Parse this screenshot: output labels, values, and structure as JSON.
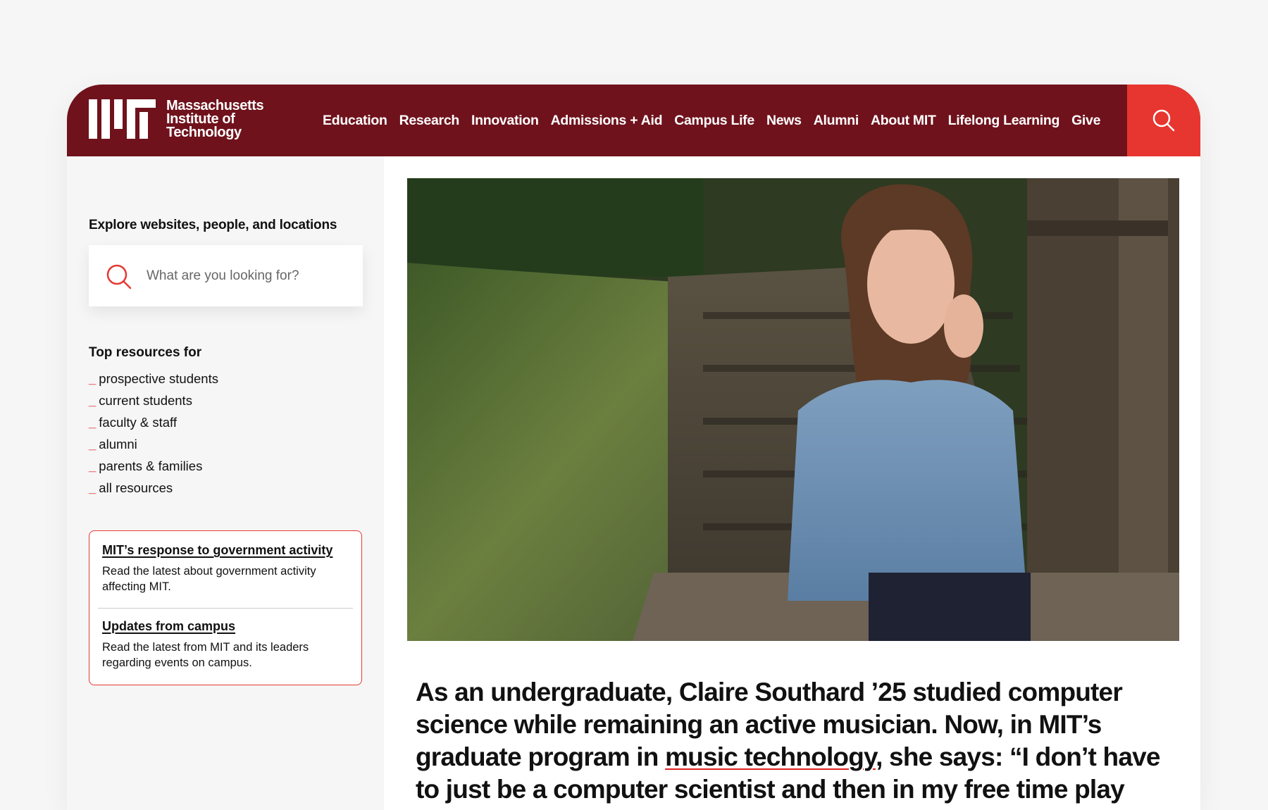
{
  "header": {
    "logo_lines": [
      "Massachusetts",
      "Institute of",
      "Technology"
    ],
    "nav": [
      "Education",
      "Research",
      "Innovation",
      "Admissions + Aid",
      "Campus Life",
      "News",
      "Alumni",
      "About MIT",
      "Lifelong Learning",
      "Give"
    ],
    "search_icon": "search-icon"
  },
  "sidebar": {
    "explore_label": "Explore websites, people, and locations",
    "search_placeholder": "What are you looking for?",
    "resources_title": "Top resources for",
    "resources": [
      "prospective students",
      "current students",
      "faculty & staff",
      "alumni",
      "parents & families",
      "all resources"
    ],
    "bullet": "_",
    "alerts": [
      {
        "title": "MIT’s response to government activity",
        "desc": "Read the latest about government activity affecting MIT."
      },
      {
        "title": "Updates from campus",
        "desc": "Read the latest from MIT and its leaders regarding events on campus."
      }
    ]
  },
  "story": {
    "text_before": "As an undergraduate, Claire Southard ’25 studied computer science while remaining an active musician. Now, in MIT’s graduate program in ",
    "link": "music technology",
    "text_after": ", she says: “I don’t have to just be a computer scientist and then in my free time play the piano.”"
  },
  "colors": {
    "brand": "#6f121c",
    "accent": "#e7352f"
  }
}
